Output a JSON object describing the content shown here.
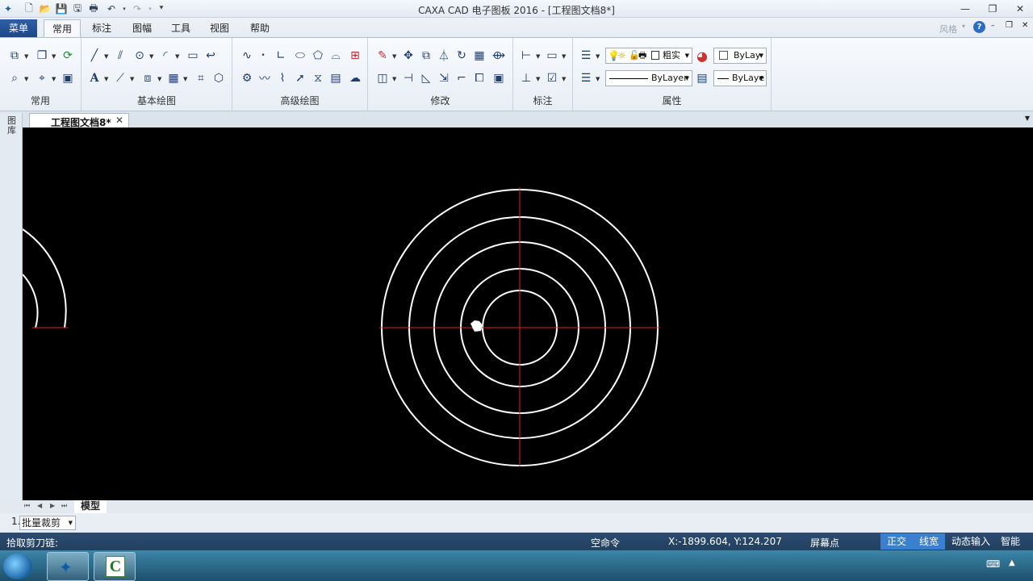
{
  "window": {
    "title": "CAXA CAD 电子图板 2016 - [工程图文档8*]",
    "app_style_label": "风格"
  },
  "menu": {
    "main_button": "菜单",
    "tabs": [
      "常用",
      "标注",
      "图幅",
      "工具",
      "视图",
      "帮助"
    ],
    "active_tab": "常用"
  },
  "ribbon": {
    "groups": [
      "常用",
      "基本绘图",
      "高级绘图",
      "修改",
      "标注",
      "属性"
    ],
    "properties": {
      "layer_name": "粗实",
      "color_value": "ByLay",
      "linetype_value": "ByLayer",
      "lineweight_value": "ByLaye"
    }
  },
  "document": {
    "tab_label": "工程图文档8*",
    "left_panel_label": "图库"
  },
  "canvas": {
    "background": "#000000",
    "line_color": "#ffffff",
    "centerline_color": "#e02020"
  },
  "sheet_tabs": {
    "model_tab": "模型"
  },
  "command": {
    "line_number": "1.",
    "command_combo": "批量裁剪"
  },
  "status": {
    "prompt": "拾取剪刀链:",
    "command_state": "空命令",
    "coordinates": "X:-1899.604, Y:124.207",
    "snap_mode": "屏幕点",
    "toggles": [
      "正交",
      "线宽",
      "动态输入",
      "智能"
    ],
    "toggles_on": [
      "正交",
      "线宽"
    ]
  },
  "colors": {
    "menu_button": "#1d4787",
    "status_bar": "#22405f",
    "status_toggle_on": "#3b7fcf"
  }
}
